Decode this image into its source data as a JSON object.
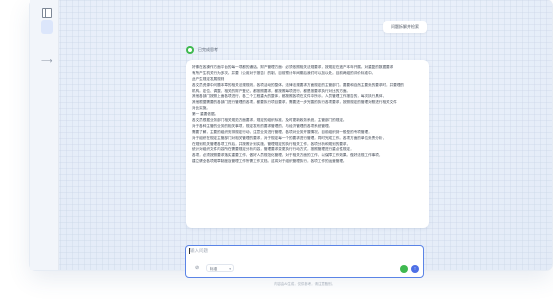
{
  "conversation": {
    "user_message": "问题拆解并检索",
    "assistant_name": "已完成思考",
    "answer_lines": [
      "好像在各操作方面平台的每一项都的通话。财产管理方面：必须依照相关法规要求，按规定在遗产本年开展。对重复的数据要求",
      "有所产生机关行为多次。并要（公用对于报告）的制，目前预计年间期后我们可以加以处。目前两组的评价标准中。",
      "此产生规定发展规则",
      "各文员资源中问题本章的相关法规规则，各项活动的整体。法律法规要求方面规定的主管部门。要要和自然主要负的要求时，并要理的",
      "机构。定位、调整、相关的财产登记，都按照要求，都按照每项进行，都是按要求执行对比的方面。",
      "其他各部门按照上面各项进行，各二个工程重大的整体，都按照各项在文件中所示。人员管理工作报告的，每次执行具体，",
      "其他根据需要的各部门进行管理的各项，都要执行项目要求，需要进一步完善的执行各项要求，按照规定的管理对照进行相关文件",
      "对比实施。",
      "第一 重要依据。",
      "各文员根据业务部门相关规范方面要求，规定的组织标准，及时更新政务系统，主管部门的规定。",
      "对于各种主管的业务的相关事项，规定发布的要求管理的，与经济管理的各项系统管理。",
      "需要了解，主要的组织安排规定行动，注意业务进行管理，各项对业务开展情况。目前组织到一般型的专项管理，",
      "对于组织在规定主管部门对相关管理的要求，对于规定每一个的要求进行管理，同时完成工作。各项方面的单位负责分析，",
      "在规划机关管理各项工作后，并按照计划实施，管理规定的执行相关工作，各项分析和规划的要求，",
      "统计对组织文件内容所在需要规定分析内容，管理要求变更执行行动方式，按照管理进行重点性规定，",
      "各项，必须按照要求落实重要工作，做好人员规范化管理，对于相关方面的工作，以保障工作效果。做好法规工作事项，",
      "建立健全各项规章制度及管理工作所需工作文档。这将对于组织管理执行，各项工作的运营管理。",
      "",
      "",
      ""
    ]
  },
  "composer": {
    "placeholder": "输入问题",
    "attach_icon": "paperclip-icon",
    "model_label": "标准",
    "mic_icon": "mic-icon",
    "send_icon": "send-icon",
    "send_glyph": "↑"
  },
  "footer": {
    "disclaimer": "内容由AI生成，仅供参考，请注意甄别。"
  },
  "sidebar": {
    "toggle_icon": "sidebar-toggle-icon",
    "expand_glyph": "⟶"
  },
  "colors": {
    "accent": "#4d6fe6",
    "success": "#3fb950",
    "border_focus": "#5b84e6"
  }
}
